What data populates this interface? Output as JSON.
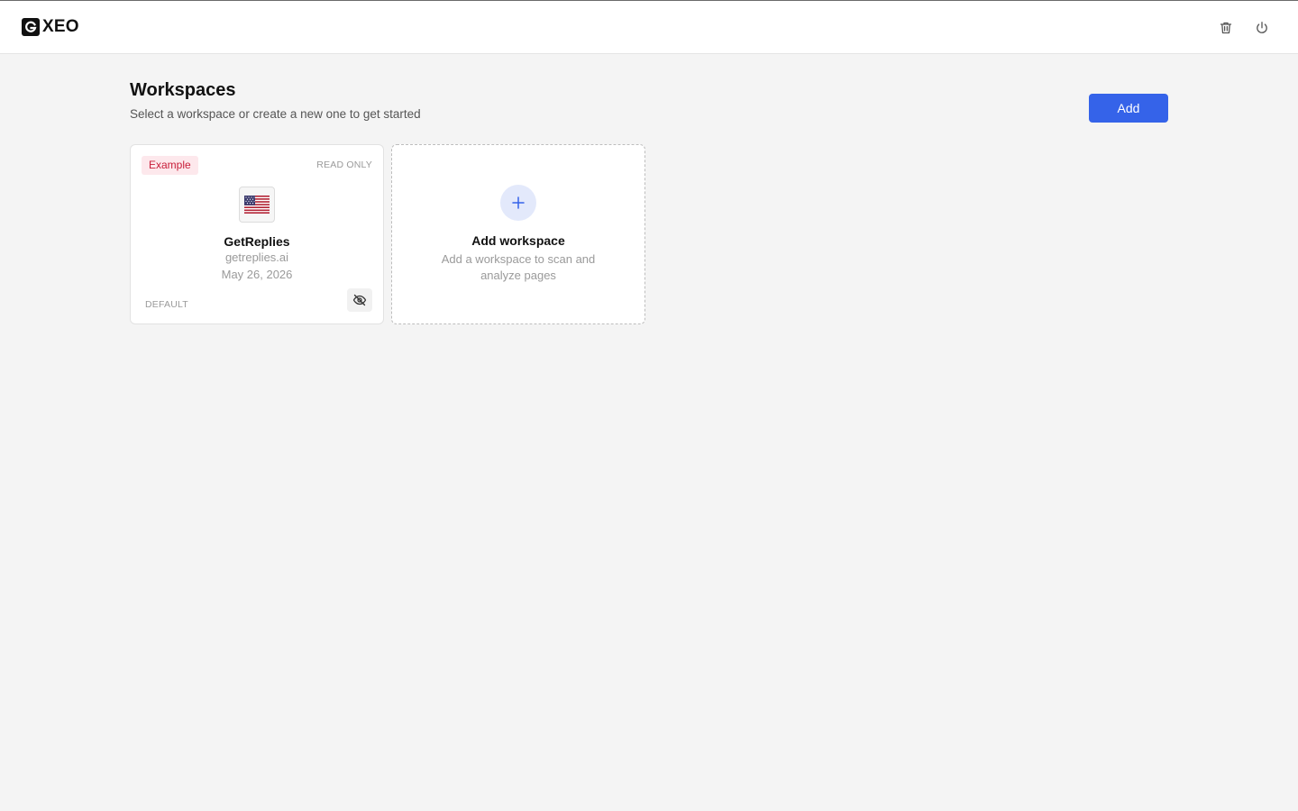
{
  "app": {
    "name": "XEO"
  },
  "header": {
    "icons": [
      "trash-icon",
      "power-icon"
    ]
  },
  "page": {
    "title": "Workspaces",
    "subtitle": "Select a workspace or create a new one to get started",
    "add_button_label": "Add"
  },
  "workspaces": [
    {
      "badge": "Example",
      "access": "READ ONLY",
      "flag": "us-flag-icon",
      "name": "GetReplies",
      "domain": "getreplies.ai",
      "date": "May 26, 2026",
      "label": "DEFAULT",
      "action_icon": "eye-off-icon"
    }
  ],
  "add_workspace": {
    "icon": "plus-icon",
    "title": "Add workspace",
    "description": "Add a workspace to scan and analyze pages"
  },
  "colors": {
    "accent": "#3563e9",
    "badge_bg": "#fde8ec",
    "badge_text": "#c81e3a",
    "background": "#f4f4f4"
  }
}
